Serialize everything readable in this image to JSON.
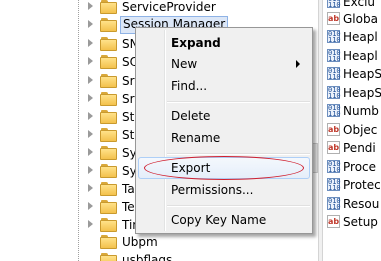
{
  "tree": {
    "items": [
      {
        "label": "ServiceProvider",
        "top": 0
      },
      {
        "label": "Session Manager",
        "selected": true
      },
      {
        "label": "SN"
      },
      {
        "label": "SQ"
      },
      {
        "label": "Srp"
      },
      {
        "label": "Srp"
      },
      {
        "label": "Stil"
      },
      {
        "label": "Sto"
      },
      {
        "label": "Sys"
      },
      {
        "label": "Sys"
      },
      {
        "label": "Tal"
      },
      {
        "label": "Ter"
      },
      {
        "label": "Tim"
      },
      {
        "label": "Ubpm"
      },
      {
        "label": "usbflags"
      }
    ]
  },
  "values": {
    "items": [
      {
        "icon": "binary",
        "label": "Exclu"
      },
      {
        "icon": "string",
        "label": "Globa"
      },
      {
        "icon": "binary",
        "label": "Heapl"
      },
      {
        "icon": "binary",
        "label": "Heapl"
      },
      {
        "icon": "binary",
        "label": "HeapS"
      },
      {
        "icon": "binary",
        "label": "HeapS"
      },
      {
        "icon": "binary",
        "label": "Numb"
      },
      {
        "icon": "string",
        "label": "Objec"
      },
      {
        "icon": "string",
        "label": "Pendi"
      },
      {
        "icon": "binary",
        "label": "Proce"
      },
      {
        "icon": "binary",
        "label": "Protec"
      },
      {
        "icon": "binary",
        "label": "Resou"
      },
      {
        "icon": "string",
        "label": "Setup"
      }
    ]
  },
  "context_menu": {
    "items": [
      {
        "label": "Expand",
        "bold": true
      },
      {
        "label": "New",
        "submenu": true
      },
      {
        "label": "Find..."
      },
      {
        "separator": true
      },
      {
        "label": "Delete"
      },
      {
        "label": "Rename"
      },
      {
        "separator": true
      },
      {
        "label": "Export",
        "hover": true
      },
      {
        "label": "Permissions..."
      },
      {
        "separator": true
      },
      {
        "label": "Copy Key Name"
      }
    ]
  },
  "colors": {
    "menu_background": "#f0f0f0",
    "highlight_border": "#aecff7",
    "annotation_ellipse": "#d02030",
    "folder": "#f3c14c"
  }
}
